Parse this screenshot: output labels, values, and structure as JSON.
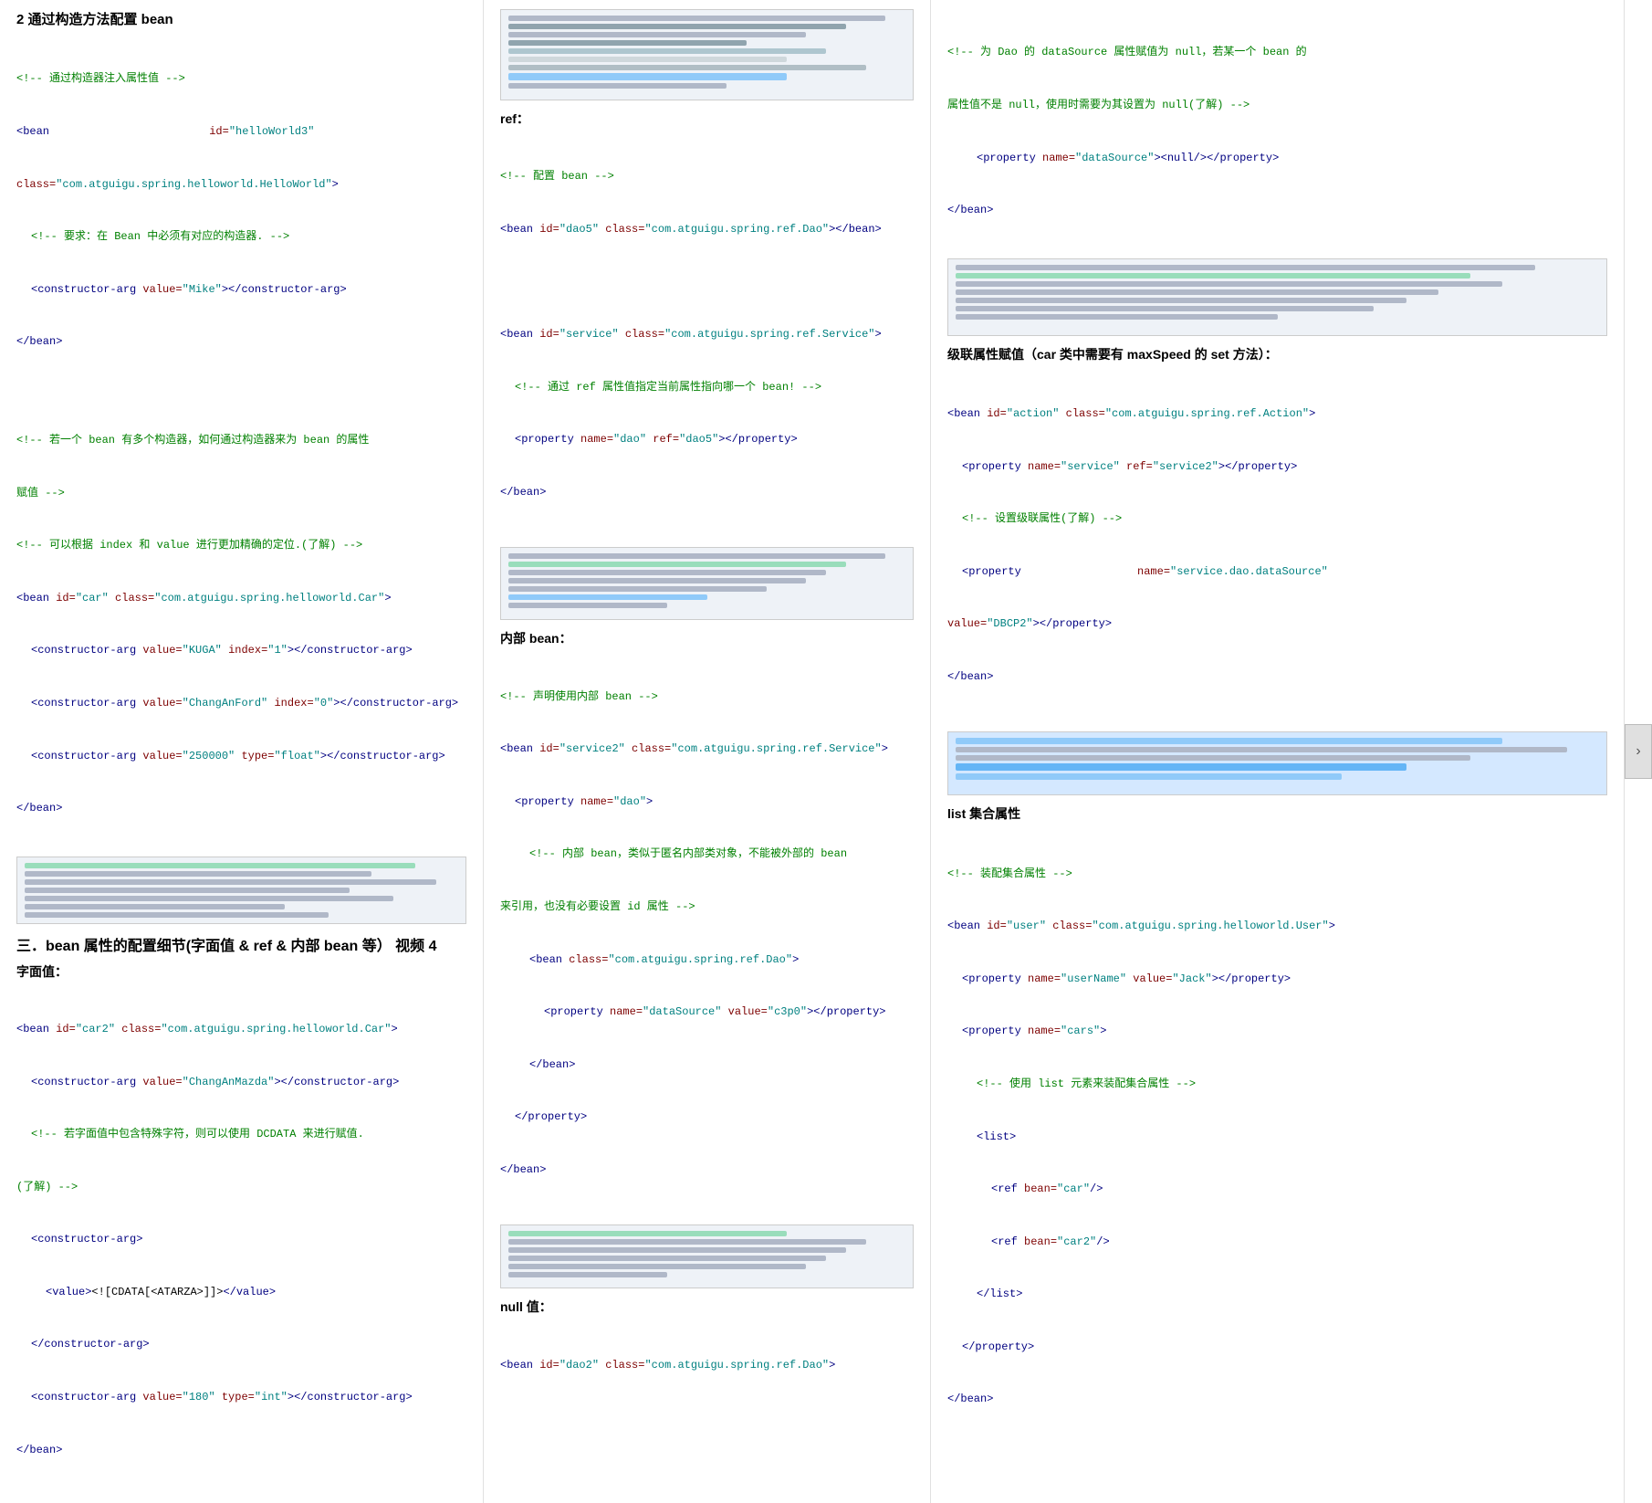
{
  "columns": {
    "col1": {
      "section2_title": "2 通过构造方法配置 bean",
      "col1_lines": [
        "<!-- 通过构造器注入属性值 -->",
        "<bean                                        id=\"helloWorld3\"",
        "class=\"com.atguigu.spring.helloworld.HelloWorld\">",
        "    <!-- 要求：在 Bean 中必须有对应的构造器. -->",
        "    <constructor-arg value=\"Mike\"></constructor-arg>",
        "</bean>",
        "",
        "<!-- 若一个 bean 有多个构造器，如何通过构造器来为 bean 的属性",
        "赋值 -->",
        "<!-- 可以根据 index 和 value 进行更加精确的定位.(了解) -->",
        "<bean id=\"car\" class=\"com.atguigu.spring.helloworld.Car\">",
        "    <constructor-arg value=\"KUGA\" index=\"1\"></constructor-arg>",
        "    <constructor-arg value=\"ChangAnFord\" index=\"0\"></constructor-arg>",
        "    <constructor-arg value=\"250000\" type=\"float\"></constructor-arg>",
        "</bean>"
      ],
      "section3_title": "三．bean 属性的配置细节(字面值 & ref & 内部 bean 等）  视频 4",
      "literal_title": "字面值：",
      "literal_lines": [
        "<bean id=\"car2\" class=\"com.atguigu.spring.helloworld.Car\">",
        "    <constructor-arg value=\"ChangAnMazda\"></constructor-arg>",
        "    <!-- 若字面值中包含特殊字符，则可以使用 DCDATA 来进行赋值.",
        "(了解) -->",
        "    <constructor-arg>",
        "        <value><![CDATA[<ATARZA>]]></value>",
        "    </constructor-arg>",
        "    <constructor-arg value=\"180\" type=\"int\"></constructor-arg>",
        "</bean>"
      ]
    },
    "col2": {
      "ref_title": "ref：",
      "ref_lines": [
        "<!-- 配置 bean -->",
        "<bean id=\"dao5\" class=\"com.atguigu.spring.ref.Dao\"></bean>",
        "",
        "<bean id=\"service\" class=\"com.atguigu.spring.ref.Service\">",
        "    <!-- 通过 ref 属性值指定当前属性指向哪一个 bean! -->",
        "    <property name=\"dao\" ref=\"dao5\"></property>",
        "</bean>"
      ],
      "inner_bean_title": "内部 bean：",
      "inner_bean_lines": [
        "<!-- 声明使用内部 bean -->",
        "<bean id=\"service2\" class=\"com.atguigu.spring.ref.Service\">",
        "    <property name=\"dao\">",
        "        <!-- 内部 bean，类似于匿名内部类对象，不能被外部的 bean",
        "来引用，也没有必要设置 id 属性 -->",
        "        <bean class=\"com.atguigu.spring.ref.Dao\">",
        "            <property name=\"dataSource\" value=\"c3p0\"></property>",
        "        </bean>",
        "    </property>",
        "</bean>"
      ],
      "null_title": "null 值：",
      "null_lines": [
        "<bean id=\"dao2\" class=\"com.atguigu.spring.ref.Dao\">"
      ]
    },
    "col3": {
      "dao_comment_lines": [
        "<!-- 为 Dao 的 dataSource 属性赋值为 null，若某一个 bean 的",
        "属性值不是 null，使用时需要为其设置为 null(了解) -->",
        "    <property name=\"dataSource\"><null/></property>",
        "</bean>"
      ],
      "cascade_title": "级联属性赋值（car 类中需要有 maxSpeed 的 set 方法）：",
      "cascade_lines": [
        "<bean id=\"action\" class=\"com.atguigu.spring.ref.Action\">",
        "    <property name=\"service\" ref=\"service2\"></property>",
        "    <!-- 设置级联属性(了解) -->",
        "    <property                       name=\"service.dao.dataSource\"",
        "value=\"DBCP2\"></property>",
        "</bean>"
      ],
      "list_title": "list 集合属性",
      "list_lines": [
        "<!-- 装配集合属性 -->",
        "<bean id=\"user\" class=\"com.atguigu.spring.helloworld.User\">",
        "    <property name=\"userName\" value=\"Jack\"></property>",
        "    <property name=\"cars\">",
        "        <!-- 使用 list 元素来装配集合属性 -->",
        "        <list>",
        "            <ref bean=\"car\"/>",
        "            <ref bean=\"car2\"/>",
        "        </list>",
        "    </property>",
        "</bean>"
      ]
    }
  },
  "nav": {
    "arrow": "›"
  }
}
